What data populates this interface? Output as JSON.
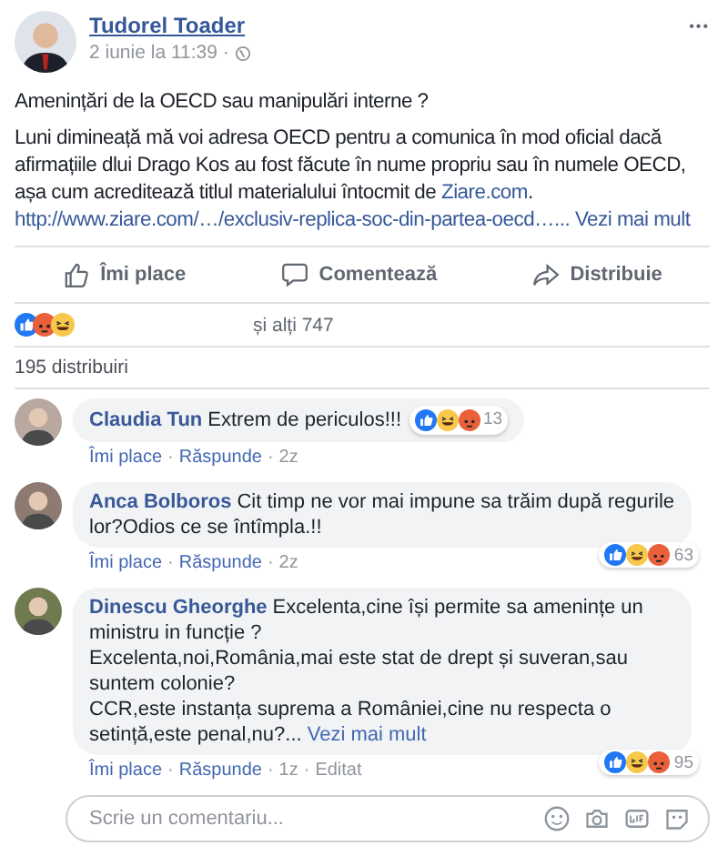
{
  "post": {
    "author": "Tudorel Toader",
    "time": "2 iunie la 11:39 ·",
    "more": "•••",
    "title": "Amenințări de la OECD sau manipulări interne ?",
    "body": "Luni dimineață mă voi adresa OECD pentru a comunica în mod oficial dacă afirmațiile dlui Drago Kos au fost făcute în nume propriu sau în numele OECD, așa cum acreditează titlul materialului întocmit de ",
    "body_link": "Ziare.com",
    "body_end": ".",
    "url": "http://www.ziare.com/…/exclusiv-replica-soc-din-partea-oecd…...",
    "see_more": "Vezi mai mult"
  },
  "actions": [
    {
      "kind": "like",
      "label": "Îmi place"
    },
    {
      "kind": "comment",
      "label": "Comentează"
    },
    {
      "kind": "share",
      "label": "Distribuie"
    }
  ],
  "reactions": {
    "others": "și alți 747"
  },
  "shares": "195 distribuiri",
  "comments": [
    {
      "author": "Claudia Tun",
      "text": "Extrem de periculos!!!",
      "inline_reactions": true,
      "count": "13",
      "like": "Îmi place",
      "sep1": "·",
      "reply": "Răspunde",
      "sep2": "·",
      "time": "2z"
    },
    {
      "author": "Anca Bolboros",
      "text": "Cit timp ne vor mai impune sa trăim după regurile lor?Odios ce se întîmpla.!!",
      "inline_reactions": false,
      "count": "63",
      "like": "Îmi place",
      "sep1": "·",
      "reply": "Răspunde",
      "sep2": "·",
      "time": "2z"
    },
    {
      "author": "Dinescu Gheorghe",
      "text": "Excelenta,cine își permite sa amenințe un ministru in funcție ?\nExcelenta,noi,România,mai este stat de drept și suveran,sau suntem colonie?\nCCR,este instanța suprema a României,cine nu respecta o setință,este penal,nu?...",
      "see_more": "Vezi mai mult",
      "inline_reactions": false,
      "count": "95",
      "like": "Îmi place",
      "sep1": "·",
      "reply": "Răspunde",
      "sep2": "·",
      "time": "1z",
      "sep3": "·",
      "edited": "Editat"
    }
  ],
  "composer": {
    "placeholder": "Scrie un comentariu..."
  }
}
